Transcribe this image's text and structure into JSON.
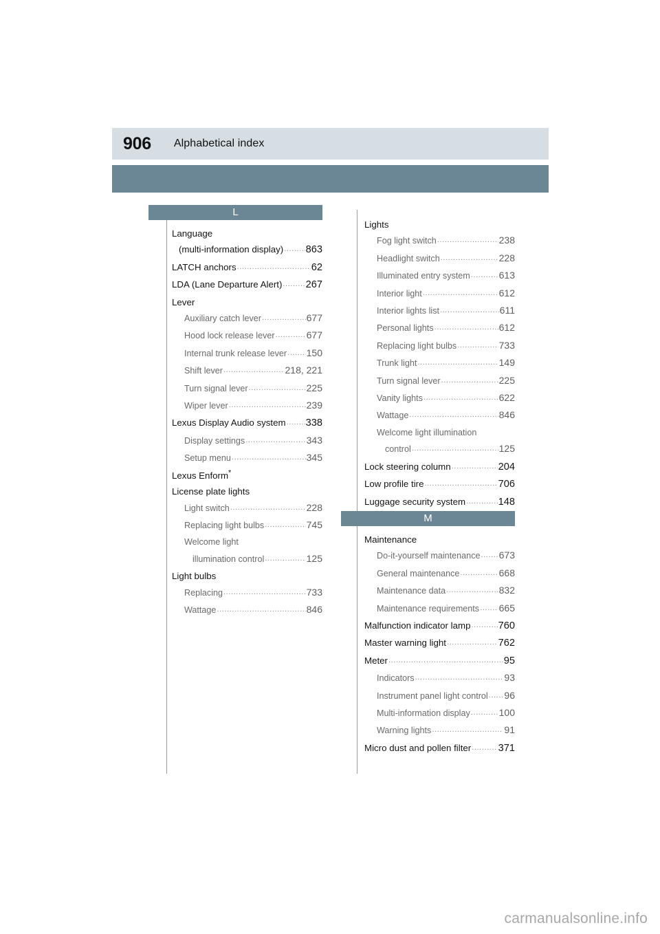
{
  "page": {
    "number": "906",
    "title": "Alphabetical index",
    "watermark": "carmanualsonline.info"
  },
  "colors": {
    "header_band": "#d6dee4",
    "accent_bar": "#6b8795",
    "rule": "#9a9a9a",
    "subentry_text": "#6a6a6a"
  },
  "columns": [
    {
      "name": "left",
      "sections": [
        {
          "letter": "L",
          "entries": [
            {
              "level": 0,
              "text": "Language",
              "page": ""
            },
            {
              "level": 0,
              "cont": true,
              "text": "(multi-information display)",
              "page": "863"
            },
            {
              "level": 0,
              "text": "LATCH anchors",
              "page": "62"
            },
            {
              "level": 0,
              "text": "LDA (Lane Departure Alert)",
              "page": "267"
            },
            {
              "level": 0,
              "text": "Lever",
              "page": ""
            },
            {
              "level": 1,
              "text": "Auxiliary catch lever",
              "page": "677"
            },
            {
              "level": 1,
              "text": "Hood lock release lever",
              "page": "677"
            },
            {
              "level": 1,
              "text": "Internal trunk release lever",
              "page": "150"
            },
            {
              "level": 1,
              "text": "Shift lever",
              "page": "218, 221"
            },
            {
              "level": 1,
              "text": "Turn signal lever",
              "page": "225"
            },
            {
              "level": 1,
              "text": "Wiper lever",
              "page": "239"
            },
            {
              "level": 0,
              "text": "Lexus Display Audio system",
              "page": "338"
            },
            {
              "level": 1,
              "text": "Display settings",
              "page": "343"
            },
            {
              "level": 1,
              "text": "Setup menu",
              "page": "345"
            },
            {
              "level": 0,
              "text": "Lexus Enform",
              "page": "",
              "star": true
            },
            {
              "level": 0,
              "text": "License plate lights",
              "page": ""
            },
            {
              "level": 1,
              "text": "Light switch",
              "page": "228"
            },
            {
              "level": 1,
              "text": "Replacing light bulbs",
              "page": "745"
            },
            {
              "level": 1,
              "text": "Welcome light",
              "page": ""
            },
            {
              "level": 2,
              "text": "illumination control",
              "page": "125"
            },
            {
              "level": 0,
              "text": "Light bulbs",
              "page": ""
            },
            {
              "level": 1,
              "text": "Replacing",
              "page": "733"
            },
            {
              "level": 1,
              "text": "Wattage",
              "page": "846"
            }
          ]
        }
      ]
    },
    {
      "name": "right",
      "sections": [
        {
          "letter": "",
          "entries": [
            {
              "level": 0,
              "text": "Lights",
              "page": ""
            },
            {
              "level": 1,
              "text": "Fog light switch",
              "page": "238"
            },
            {
              "level": 1,
              "text": "Headlight switch",
              "page": "228"
            },
            {
              "level": 1,
              "text": "Illuminated entry system",
              "page": "613"
            },
            {
              "level": 1,
              "text": "Interior light",
              "page": "612"
            },
            {
              "level": 1,
              "text": "Interior lights list",
              "page": "611"
            },
            {
              "level": 1,
              "text": "Personal lights",
              "page": "612"
            },
            {
              "level": 1,
              "text": "Replacing light bulbs",
              "page": "733"
            },
            {
              "level": 1,
              "text": "Trunk light",
              "page": "149"
            },
            {
              "level": 1,
              "text": "Turn signal lever",
              "page": "225"
            },
            {
              "level": 1,
              "text": "Vanity lights",
              "page": "622"
            },
            {
              "level": 1,
              "text": "Wattage",
              "page": "846"
            },
            {
              "level": 1,
              "text": "Welcome light illumination",
              "page": ""
            },
            {
              "level": 2,
              "text": "control",
              "page": "125"
            },
            {
              "level": 0,
              "text": "Lock steering column",
              "page": "204"
            },
            {
              "level": 0,
              "text": "Low profile tire",
              "page": "706"
            },
            {
              "level": 0,
              "text": "Luggage security system",
              "page": "148"
            }
          ]
        },
        {
          "letter": "M",
          "entries": [
            {
              "level": 0,
              "text": "Maintenance",
              "page": ""
            },
            {
              "level": 1,
              "text": "Do-it-yourself maintenance",
              "page": "673"
            },
            {
              "level": 1,
              "text": "General maintenance",
              "page": "668"
            },
            {
              "level": 1,
              "text": "Maintenance data",
              "page": "832"
            },
            {
              "level": 1,
              "text": "Maintenance requirements",
              "page": "665"
            },
            {
              "level": 0,
              "text": "Malfunction indicator lamp",
              "page": "760"
            },
            {
              "level": 0,
              "text": "Master warning light",
              "page": "762"
            },
            {
              "level": 0,
              "text": "Meter",
              "page": "95"
            },
            {
              "level": 1,
              "text": "Indicators",
              "page": "93"
            },
            {
              "level": 1,
              "text": "Instrument panel light control",
              "page": "96"
            },
            {
              "level": 1,
              "text": "Multi-information display",
              "page": "100"
            },
            {
              "level": 1,
              "text": "Warning lights",
              "page": "91"
            },
            {
              "level": 0,
              "text": "Micro dust and pollen filter",
              "page": "371"
            }
          ]
        }
      ]
    }
  ]
}
